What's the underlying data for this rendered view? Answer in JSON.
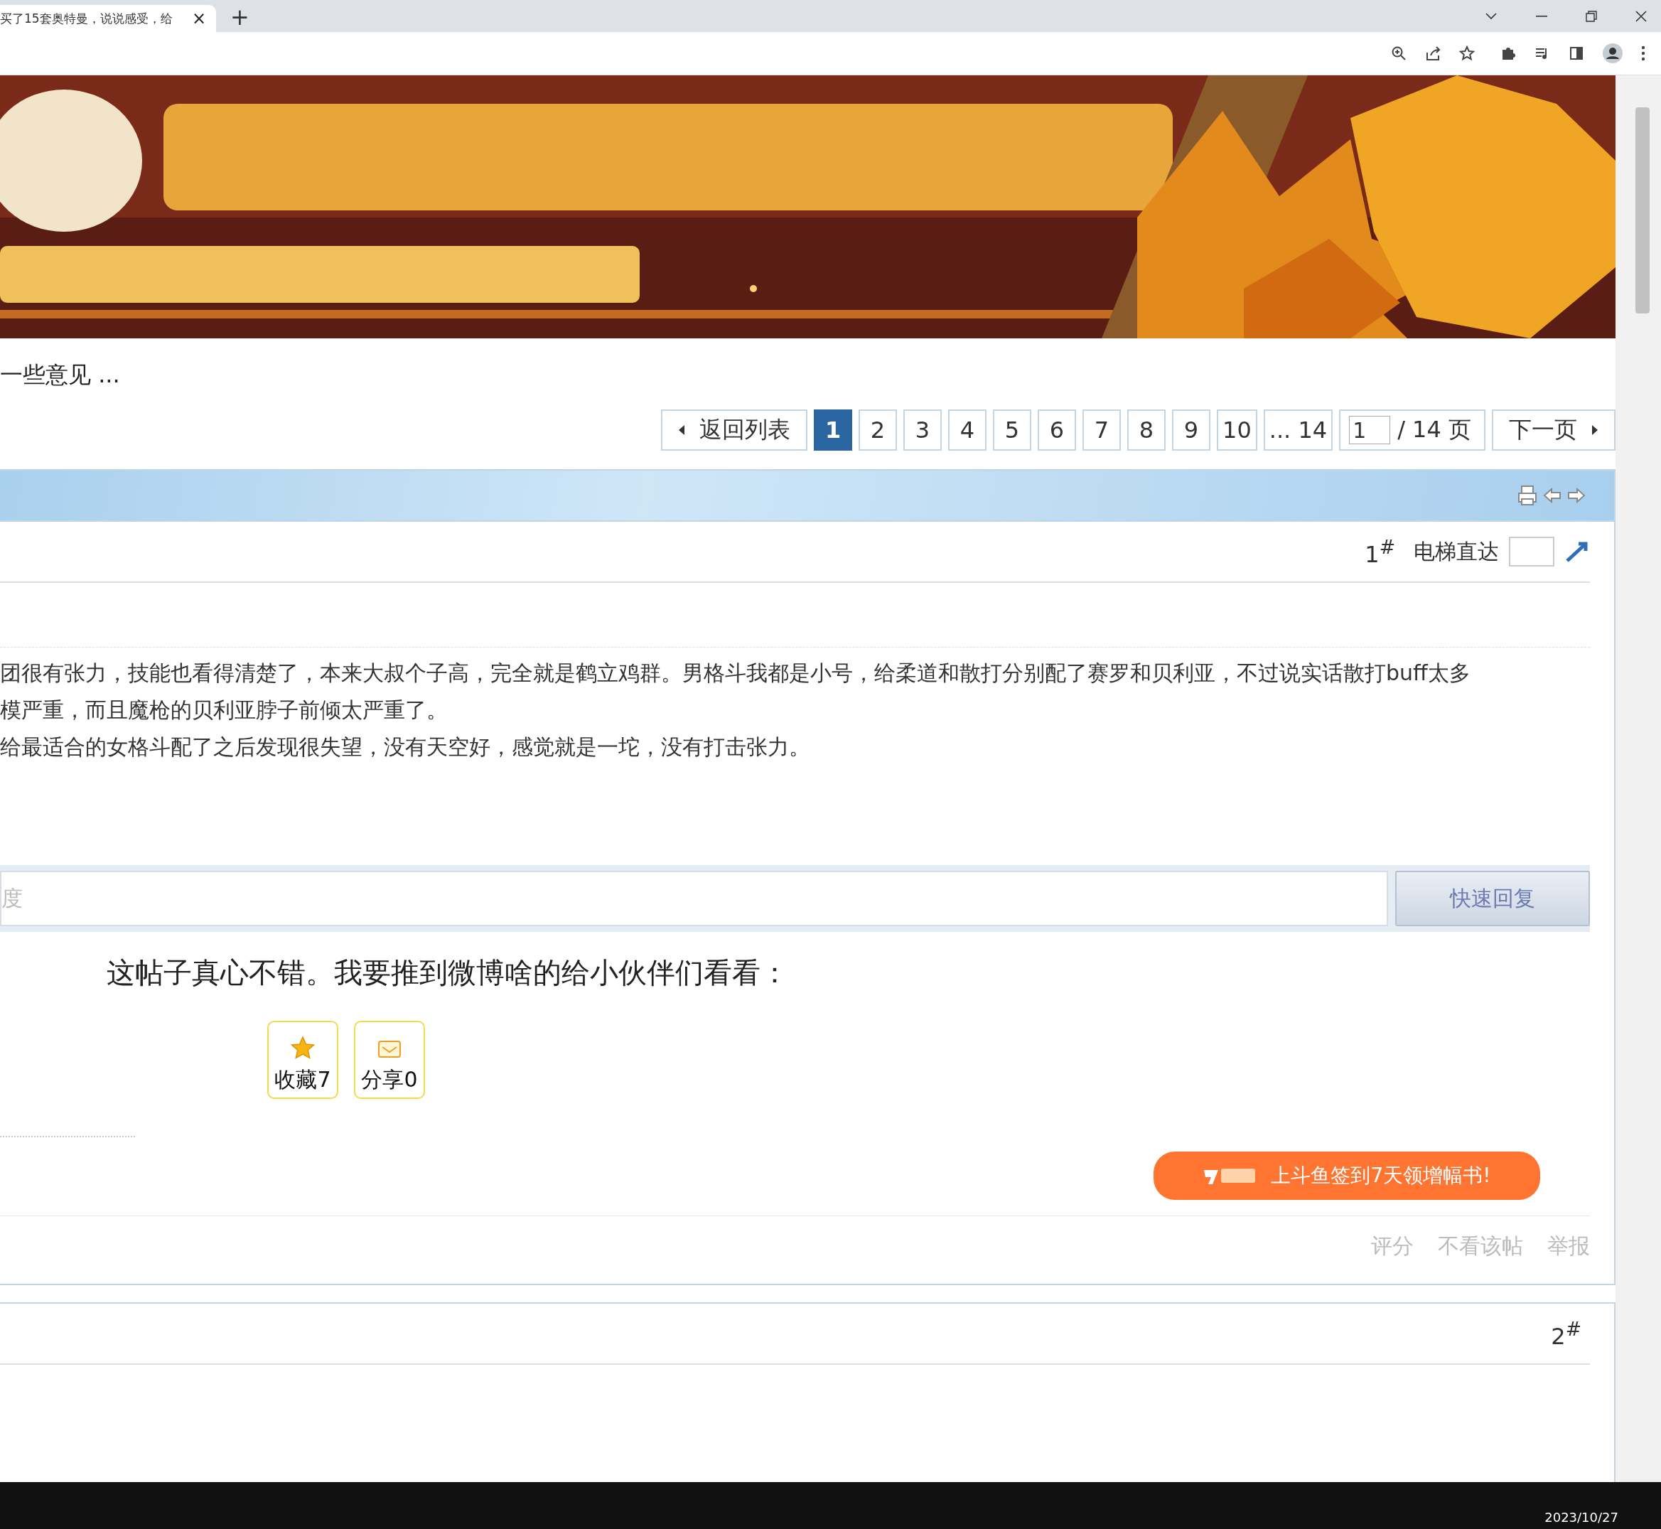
{
  "browser": {
    "tabs": [
      {
        "title": "买了15套奥特曼，说说感受，给",
        "selected": true,
        "close": "×"
      }
    ],
    "new_tab": "+"
  },
  "thread_title": "一些意见 ...",
  "pagination": {
    "back": "返回列表",
    "pages": [
      {
        "label": "1",
        "selected": true
      },
      {
        "label": "2",
        "selected": false
      },
      {
        "label": "3",
        "selected": false
      },
      {
        "label": "4",
        "selected": false
      },
      {
        "label": "5",
        "selected": false
      },
      {
        "label": "6",
        "selected": false
      },
      {
        "label": "7",
        "selected": false
      },
      {
        "label": "8",
        "selected": false
      },
      {
        "label": "9",
        "selected": false
      },
      {
        "label": "10",
        "selected": false
      },
      {
        "label": "... 14",
        "selected": false
      }
    ],
    "page_input": "1",
    "total": "/ 14 页",
    "next": "下一页"
  },
  "post": {
    "floor": "1",
    "floor_mark": "#",
    "elevator_label": "电梯直达",
    "lines": [
      "团很有张力，技能也看得清楚了，本来大叔个子高，完全就是鹤立鸡群。男格斗我都是小号，给柔道和散打分别配了赛罗和贝利亚，不过说实话散打buff太多",
      "模严重，而且魔枪的贝利亚脖子前倾太严重了。",
      "给最适合的女格斗配了之后发现很失望，没有天空好，感觉就是一坨，没有打击张力。"
    ],
    "reply_placeholder": "度",
    "reply_button": "快速回复",
    "share_text": "这帖子真心不错。我要推到微博啥的给小伙伴们看看：",
    "actions": [
      {
        "kind": "favorite",
        "label": "收藏7"
      },
      {
        "kind": "share",
        "label": "分享0"
      }
    ],
    "promo": "上斗鱼签到7天领增幅书!",
    "footer_links": [
      "评分",
      "不看该帖",
      "举报"
    ]
  },
  "post2": {
    "floor": "2",
    "floor_mark": "#"
  },
  "taskbar": {
    "date": "2023/10/27"
  }
}
